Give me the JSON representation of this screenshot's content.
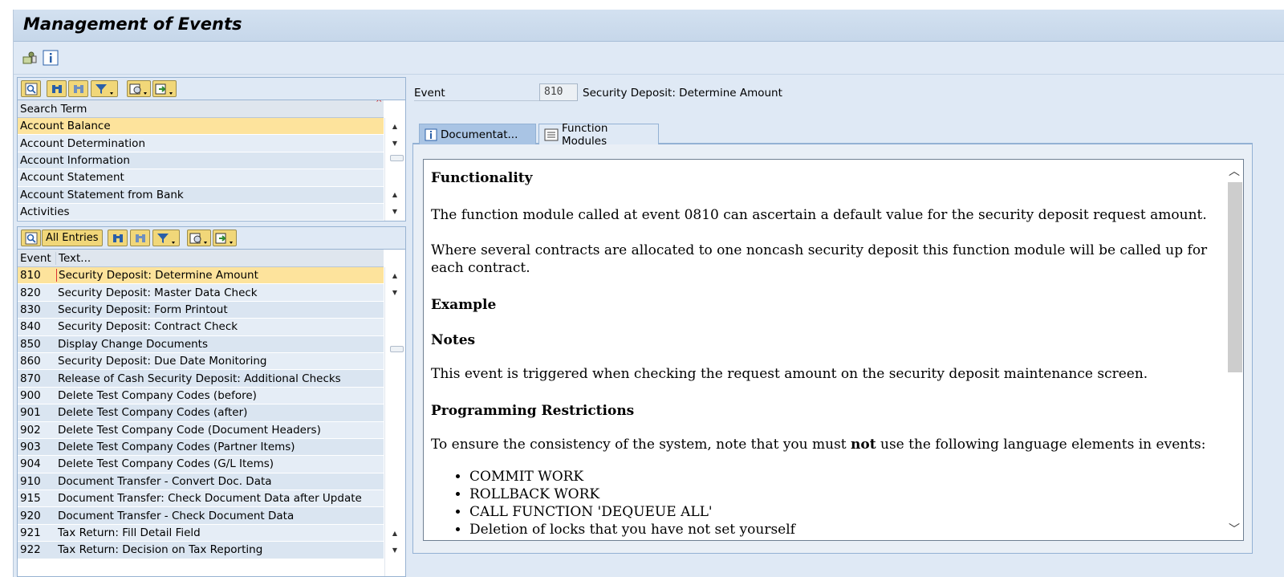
{
  "title": "Management of Events",
  "appbar": {
    "icons": [
      "object-icon",
      "info-icon"
    ]
  },
  "search_pane": {
    "header": "Search Term",
    "items": [
      {
        "label": "Account Balance",
        "selected": true
      },
      {
        "label": "Account Determination"
      },
      {
        "label": "Account Information"
      },
      {
        "label": "Account Statement"
      },
      {
        "label": "Account Statement from Bank"
      },
      {
        "label": "Activities"
      }
    ]
  },
  "events_pane": {
    "all_entries_label": "All Entries",
    "col_event": "Event",
    "col_text": "Text...",
    "rows": [
      {
        "event": "810",
        "text": "Security Deposit: Determine Amount",
        "selected": true
      },
      {
        "event": "820",
        "text": "Security Deposit: Master Data Check"
      },
      {
        "event": "830",
        "text": "Security Deposit: Form Printout"
      },
      {
        "event": "840",
        "text": "Security Deposit: Contract Check"
      },
      {
        "event": "850",
        "text": "Display Change Documents"
      },
      {
        "event": "860",
        "text": "Security Deposit: Due Date Monitoring"
      },
      {
        "event": "870",
        "text": "Release of Cash Security Deposit: Additional Checks"
      },
      {
        "event": "900",
        "text": "Delete Test Company Codes (before)"
      },
      {
        "event": "901",
        "text": "Delete Test Company Codes (after)"
      },
      {
        "event": "902",
        "text": "Delete Test Company Code (Document Headers)"
      },
      {
        "event": "903",
        "text": "Delete Test Company Codes (Partner Items)"
      },
      {
        "event": "904",
        "text": "Delete Test Company Codes (G/L Items)"
      },
      {
        "event": "910",
        "text": "Document Transfer - Convert Doc. Data"
      },
      {
        "event": "915",
        "text": "Document Transfer: Check Document Data after Update"
      },
      {
        "event": "920",
        "text": "Document Transfer - Check Document Data"
      },
      {
        "event": "921",
        "text": "Tax Return: Fill Detail Field"
      },
      {
        "event": "922",
        "text": "Tax Return: Decision on Tax Reporting"
      }
    ]
  },
  "detail": {
    "event_label": "Event",
    "event_value": "810",
    "event_text": "Security Deposit: Determine Amount",
    "tabs": [
      {
        "label": "Documentat...",
        "icon": "info-icon",
        "active": true
      },
      {
        "label": "Function Modules",
        "icon": "list-icon",
        "active": false
      }
    ],
    "doc": {
      "h_functionality": "Functionality",
      "p1": "The function module called at event 0810 can ascertain a default value for the security deposit request amount.",
      "p2": "Where several contracts are allocated to one noncash security deposit this function module will be called up for each contract.",
      "h_example": "Example",
      "h_notes": "Notes",
      "p3": "This event is triggered when checking the request amount on the security deposit maintenance screen.",
      "h_restrictions": "Programming Restrictions",
      "p4_pre": "To ensure the consistency of the system, note that you must ",
      "p4_bold": "not",
      "p4_post": " use the following language elements in events:",
      "bullets": [
        "COMMIT WORK",
        "ROLLBACK WORK",
        "CALL FUNCTION 'DEQUEUE ALL'",
        "Deletion of locks that you have not set yourself"
      ]
    }
  }
}
